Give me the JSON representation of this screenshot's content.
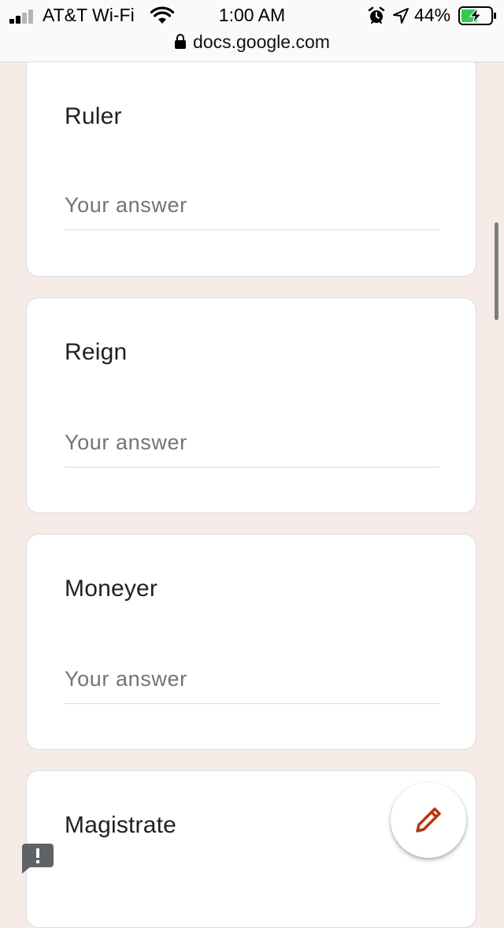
{
  "status_bar": {
    "carrier": "AT&T Wi-Fi",
    "time": "1:00 AM",
    "battery_percent": "44%",
    "icons": [
      "signal-icon",
      "wifi-icon",
      "alarm-icon",
      "location-icon",
      "battery-charging-icon"
    ]
  },
  "browser": {
    "url": "docs.google.com",
    "icon": "lock-icon"
  },
  "form": {
    "questions": [
      {
        "label": "Ruler",
        "placeholder": "Your answer"
      },
      {
        "label": "Reign",
        "placeholder": "Your answer"
      },
      {
        "label": "Moneyer",
        "placeholder": "Your answer"
      },
      {
        "label": "Magistrate"
      }
    ]
  },
  "fab": {
    "icon": "pencil-icon",
    "color": "#b7360f"
  },
  "feedback": {
    "icon": "feedback-icon"
  },
  "colors": {
    "page_background": "#f6ebe7",
    "card_background": "#ffffff",
    "card_border": "#dadce0"
  }
}
